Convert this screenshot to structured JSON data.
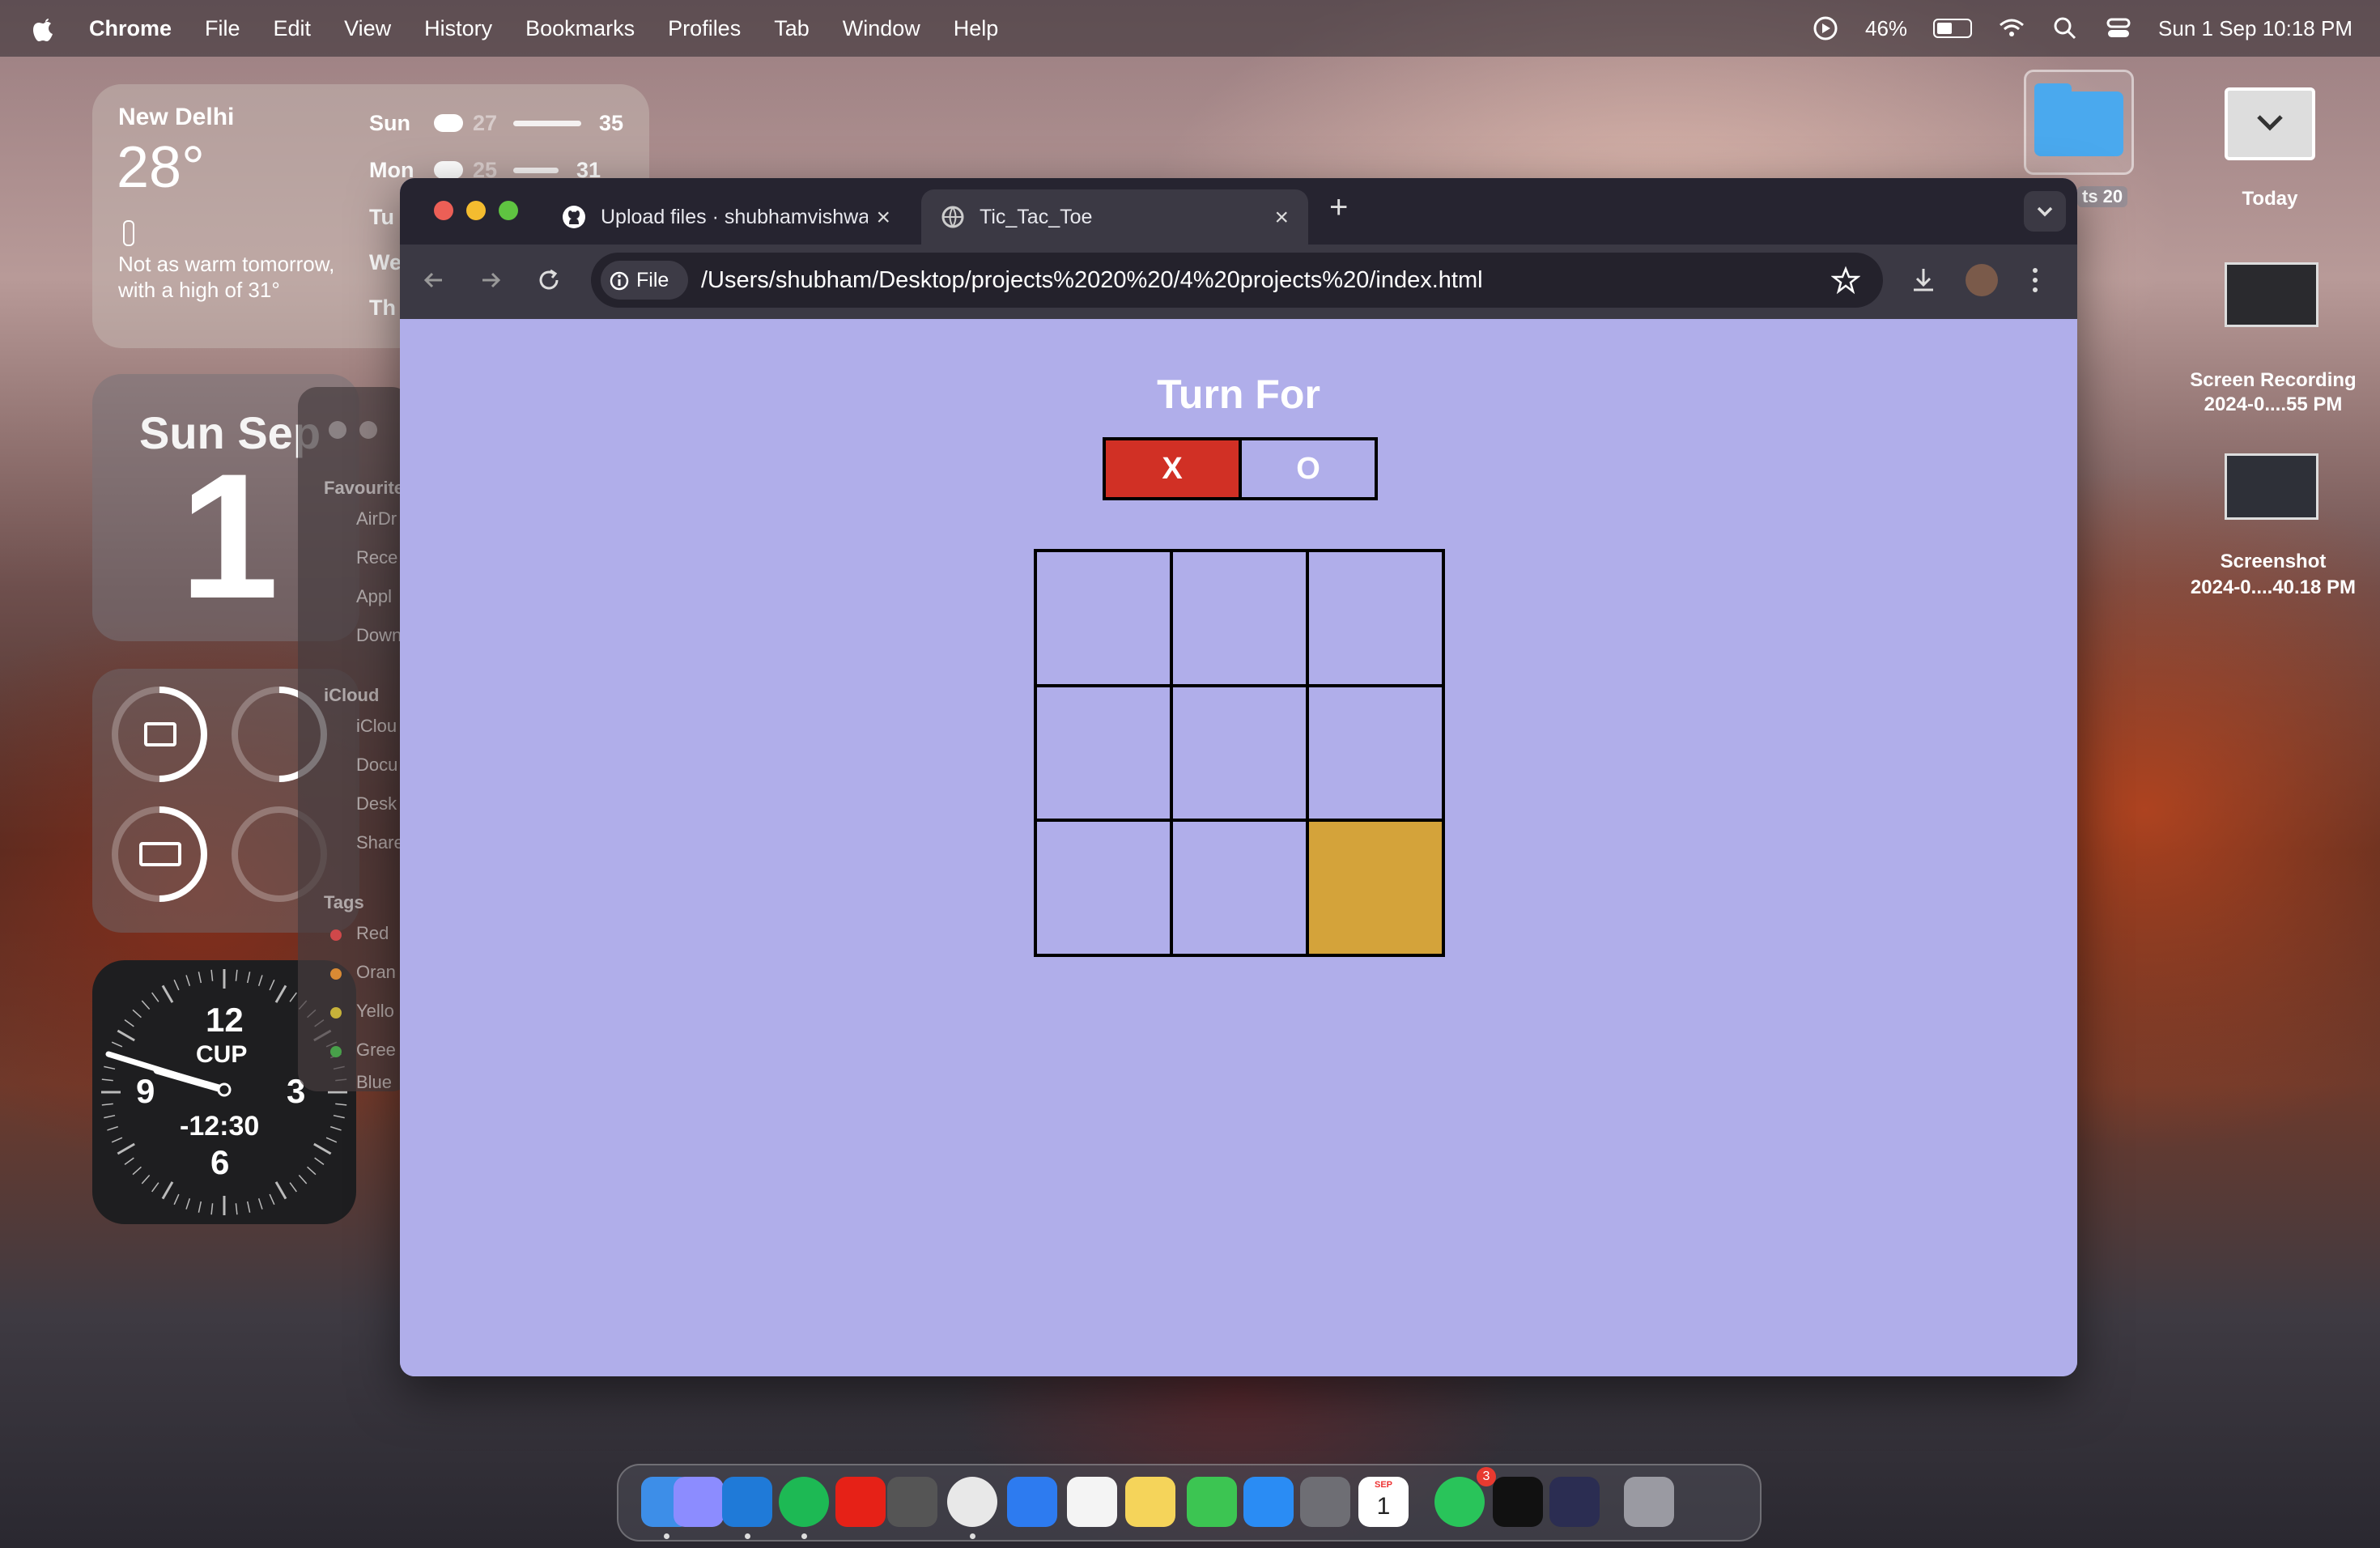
{
  "menubar": {
    "app_name": "Chrome",
    "menus": [
      "File",
      "Edit",
      "View",
      "History",
      "Bookmarks",
      "Profiles",
      "Tab",
      "Window",
      "Help"
    ],
    "battery_percent": "46%",
    "battery_level": 0.46,
    "datetime": "Sun 1 Sep  10:18 PM"
  },
  "weather": {
    "city": "New Delhi",
    "temp": "28°",
    "description": "Not as warm tomorrow, with a high of 31°",
    "forecast": [
      {
        "day": "Sun",
        "low": "27",
        "high": "35"
      },
      {
        "day": "Mon",
        "low": "25",
        "high": "31"
      },
      {
        "day": "Tu",
        "low": "",
        "high": ""
      },
      {
        "day": "We",
        "low": "",
        "high": ""
      },
      {
        "day": "Th",
        "low": "",
        "high": ""
      }
    ]
  },
  "calendar": {
    "day_label": "Sun Sep",
    "date": "1"
  },
  "clock": {
    "twelve": "12",
    "city": "CUP",
    "nine": "9",
    "three": "3",
    "offset": "-12:30",
    "six": "6"
  },
  "finder": {
    "items": [
      "Favourite",
      "AirDr",
      "Rece",
      "Appl",
      "Down",
      "iCloud",
      "iClou",
      "Docu",
      "Desk",
      "Share",
      "Tags",
      "Red",
      "Oran",
      "Yello",
      "Gree",
      "Blue"
    ]
  },
  "desktop": {
    "folder_label": "ts 20",
    "today_label": "Today",
    "recording_label_1": "Screen Recording",
    "recording_label_2": "2024-0....55 PM",
    "screenshot_label_1": "Screenshot",
    "screenshot_label_2": "2024-0....40.18 PM"
  },
  "browser": {
    "tabs": [
      {
        "title": "Upload files · shubhamvishwa",
        "active": false
      },
      {
        "title": "Tic_Tac_Toe",
        "active": true
      }
    ],
    "new_tab": "+",
    "url_chip": "File",
    "url": "/Users/shubham/Desktop/projects%2020%20/4%20projects%20/index.html"
  },
  "game": {
    "heading": "Turn For",
    "x_label": "X",
    "o_label": "O",
    "colors": {
      "page_bg": "#b0aeea",
      "x_active": "#d13025",
      "highlight": "#d4a33a"
    },
    "highlighted_cell": 9
  },
  "dock": {
    "apps": [
      "finder",
      "launchpad",
      "vscode",
      "spotify",
      "youtube",
      "keyboard",
      "chrome",
      "safari",
      "photos",
      "notes",
      "facetime",
      "app-store",
      "settings",
      "calendar",
      "whatsapp",
      "medium",
      "quicktime",
      "trash"
    ],
    "whatsapp_badge": "3",
    "calendar_month": "SEP",
    "calendar_day": "1"
  }
}
